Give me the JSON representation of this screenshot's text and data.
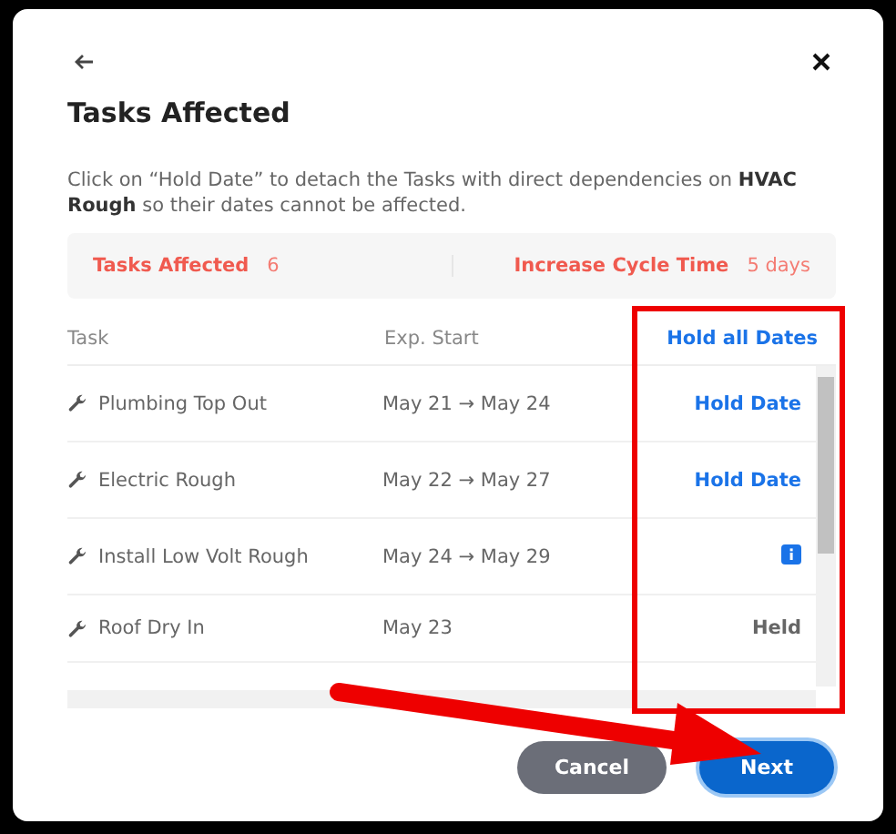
{
  "dialog": {
    "title": "Tasks Affected",
    "description": "Click on “Hold Date” to detach the Tasks with direct dependencies on **HVAC Rough** so their dates cannot be affected."
  },
  "summary": [
    {
      "label": "Tasks Affected",
      "value": "6"
    },
    {
      "label": "Increase Cycle Time",
      "value": "5 days"
    }
  ],
  "table": {
    "columns": [
      "Task",
      "Exp. Start"
    ],
    "hold_all": "Hold all Dates",
    "rows": [
      {
        "task": "Plumbing Top Out",
        "start": "May 21 → May 24",
        "action": {
          "kind": "hold",
          "label": "Hold Date"
        }
      },
      {
        "task": "Electric Rough",
        "start": "May 22 → May 27",
        "action": {
          "kind": "hold",
          "label": "Hold Date"
        }
      },
      {
        "task": "Install Low Volt Rough",
        "start": "May 24 → May 29",
        "action": {
          "kind": "info"
        }
      },
      {
        "task": "Roof Dry In",
        "start": "May 23",
        "action": {
          "kind": "held",
          "label": "Held"
        }
      }
    ]
  },
  "buttons": [
    {
      "label": "Cancel",
      "kind": "secondary"
    },
    {
      "label": "Next",
      "kind": "primary"
    }
  ]
}
